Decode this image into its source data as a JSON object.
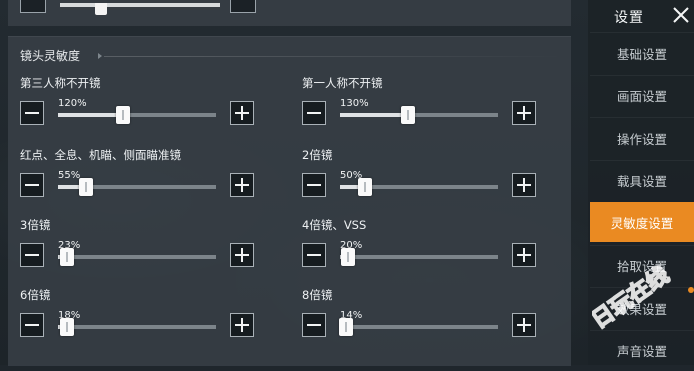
{
  "section": {
    "title": "镜头灵敏度"
  },
  "top_row": {
    "value_fraction": 0.22
  },
  "sliders": [
    {
      "label": "第三人称不开镜",
      "value": "120%",
      "fraction": 0.41
    },
    {
      "label": "第一人称不开镜",
      "value": "130%",
      "fraction": 0.43
    },
    {
      "label": "红点、全息、机瞄、侧面瞄准镜",
      "value": "55%",
      "fraction": 0.18
    },
    {
      "label": "2倍镜",
      "value": "50%",
      "fraction": 0.16
    },
    {
      "label": "3倍镜",
      "value": "23%",
      "fraction": 0.06
    },
    {
      "label": "4倍镜、VSS",
      "value": "20%",
      "fraction": 0.05
    },
    {
      "label": "6倍镜",
      "value": "18%",
      "fraction": 0.06
    },
    {
      "label": "8倍镜",
      "value": "14%",
      "fraction": 0.04
    }
  ],
  "sidebar": {
    "title": "设置",
    "items": [
      {
        "label": "基础设置"
      },
      {
        "label": "画面设置"
      },
      {
        "label": "操作设置"
      },
      {
        "label": "载具设置"
      },
      {
        "label": "灵敏度设置"
      },
      {
        "label": "拾取设置"
      },
      {
        "label": "效果设置"
      },
      {
        "label": "声音设置"
      }
    ],
    "active_index": 4
  },
  "watermark": {
    "text": "日玩在线"
  },
  "colors": {
    "accent": "#ea8a22",
    "panel": "#394148",
    "background": "#1f262c"
  },
  "icons": {
    "close": "close-icon",
    "minus": "minus-icon",
    "plus": "plus-icon"
  }
}
